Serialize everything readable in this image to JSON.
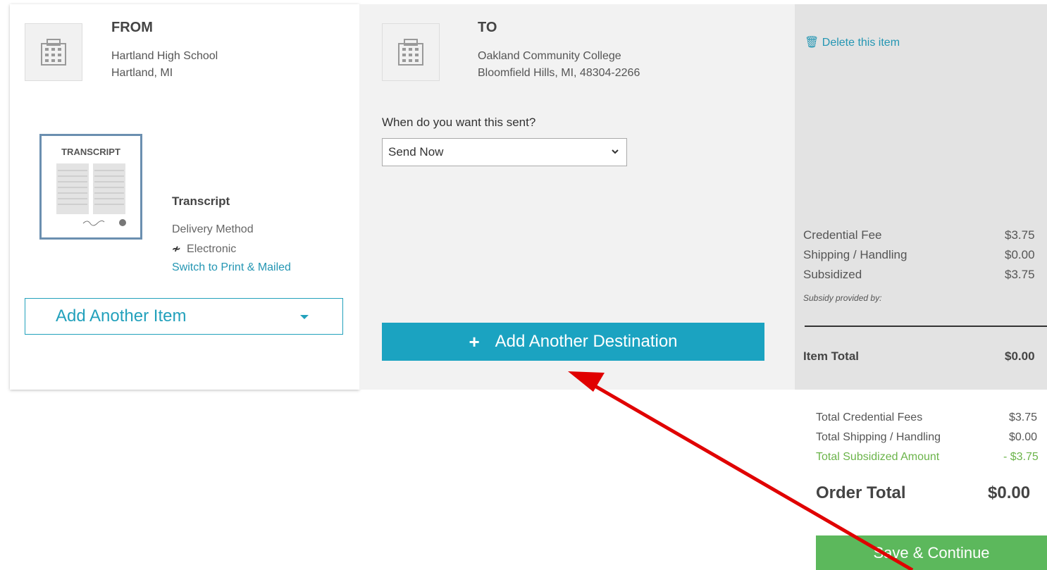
{
  "from": {
    "heading": "FROM",
    "name": "Hartland High School",
    "location": "Hartland, MI"
  },
  "to": {
    "heading": "TO",
    "name": "Oakland Community College",
    "location": "Bloomfield Hills, MI, 48304-2266"
  },
  "item": {
    "thumb_title": "TRANSCRIPT",
    "label": "Transcript",
    "delivery_method_label": "Delivery Method",
    "delivery_method_value": "Electronic",
    "switch_link": "Switch to Print & Mailed",
    "add_another_item": "Add Another Item"
  },
  "send": {
    "question": "When do you want this sent?",
    "selected": "Send Now",
    "add_destination": "Add Another Destination"
  },
  "summary": {
    "delete_label": "Delete this item",
    "credential_fee_label": "Credential Fee",
    "credential_fee": "$3.75",
    "shipping_label": "Shipping / Handling",
    "shipping": "$0.00",
    "subsidized_label": "Subsidized",
    "subsidized": "$3.75",
    "subsidy_note": "Subsidy provided by:",
    "item_total_label": "Item Total",
    "item_total": "$0.00"
  },
  "totals": {
    "total_credential_fees_label": "Total Credential Fees",
    "total_credential_fees": "$3.75",
    "total_shipping_label": "Total Shipping / Handling",
    "total_shipping": "$0.00",
    "total_subsidized_label": "Total Subsidized Amount",
    "total_subsidized": "- $3.75",
    "order_total_label": "Order Total",
    "order_total": "$0.00",
    "save_continue": "Save & Continue"
  },
  "colors": {
    "accent": "#1ba3c1",
    "save": "#5cb85c",
    "arrow": "#e00000",
    "subsidy": "#6bb44a"
  }
}
